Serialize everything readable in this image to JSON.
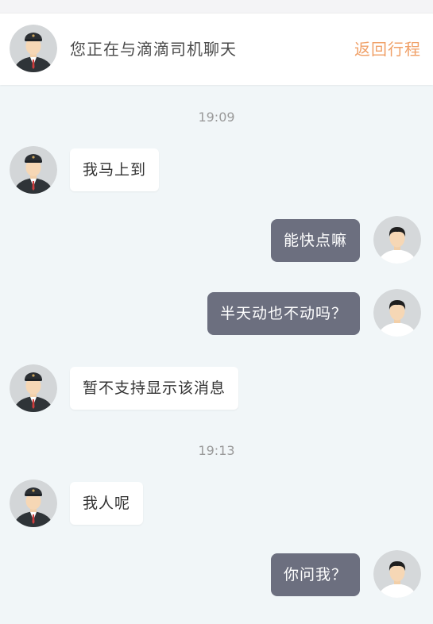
{
  "header": {
    "title": "您正在与滴滴司机聊天",
    "back_label": "返回行程",
    "back_color": "#f0a067"
  },
  "messages": {
    "t1": "19:09",
    "m1": "我马上到",
    "m2": "能快点嘛",
    "m3": "半天动也不动吗？",
    "m4": "暂不支持显示该消息",
    "t2": "19:13",
    "m5": "我人呢",
    "m6": "你问我？"
  },
  "colors": {
    "outgoing_bubble": "#6c6f7f",
    "incoming_bubble": "#ffffff",
    "chat_background": "#f1f6f8"
  },
  "icons": {
    "driver_avatar": "driver-avatar-icon",
    "user_avatar": "user-avatar-icon"
  }
}
